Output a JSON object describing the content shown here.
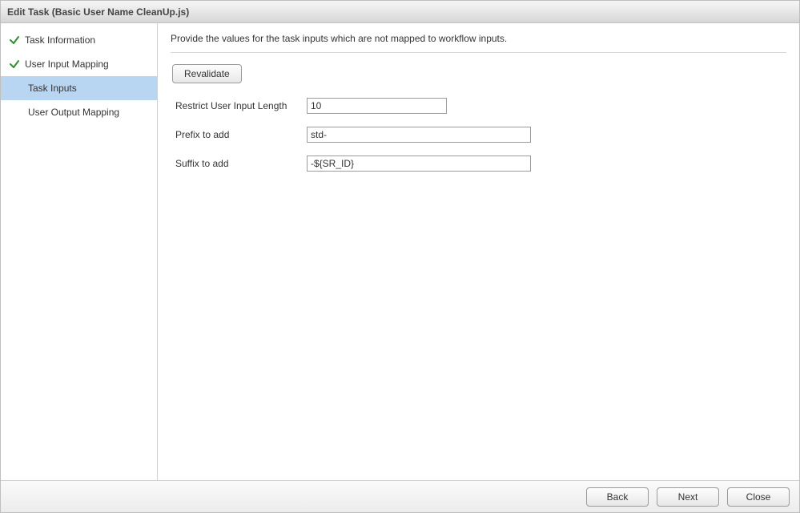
{
  "dialog": {
    "title": "Edit Task (Basic User Name CleanUp.js)"
  },
  "sidebar": {
    "items": [
      {
        "label": "Task Information",
        "checked": true,
        "selected": false
      },
      {
        "label": "User Input Mapping",
        "checked": true,
        "selected": false
      },
      {
        "label": "Task Inputs",
        "checked": false,
        "selected": true
      },
      {
        "label": "User Output Mapping",
        "checked": false,
        "selected": false
      }
    ]
  },
  "content": {
    "description": "Provide the values for the task inputs which are not mapped to workflow inputs.",
    "revalidate_label": "Revalidate",
    "fields": {
      "restrict_label": "Restrict User Input Length",
      "restrict_value": "10",
      "prefix_label": "Prefix to add",
      "prefix_value": "std-",
      "suffix_label": "Suffix to add",
      "suffix_value": "-${SR_ID}"
    }
  },
  "footer": {
    "back": "Back",
    "next": "Next",
    "close": "Close"
  }
}
